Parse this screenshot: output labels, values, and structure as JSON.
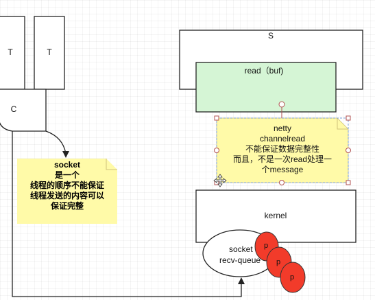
{
  "thread_boxes": [
    {
      "label": "T"
    },
    {
      "label": "T"
    }
  ],
  "client_box": {
    "label": "C"
  },
  "server_box": {
    "label": "S"
  },
  "read_box": {
    "label": "read（buf)"
  },
  "kernel_box": {
    "label": "kernel"
  },
  "socket_note": {
    "lines": [
      "socket",
      "是一个",
      "线程的顺序不能保证",
      "线程发送的内容可以",
      "保证完整"
    ]
  },
  "netty_note": {
    "lines": [
      "netty",
      "channelread",
      "不能保证数据完整性",
      "而且，不是一次read处理一",
      "个message"
    ]
  },
  "recv_queue": {
    "lines": [
      "socket",
      "recv-queue"
    ]
  },
  "packets": [
    {
      "label": "p"
    },
    {
      "label": "p"
    },
    {
      "label": "p"
    }
  ],
  "colors": {
    "note_fill": "#fffaa8",
    "read_fill": "#d5f5d5",
    "packet_fill": "#f23b2a",
    "handle": "#b05050"
  }
}
